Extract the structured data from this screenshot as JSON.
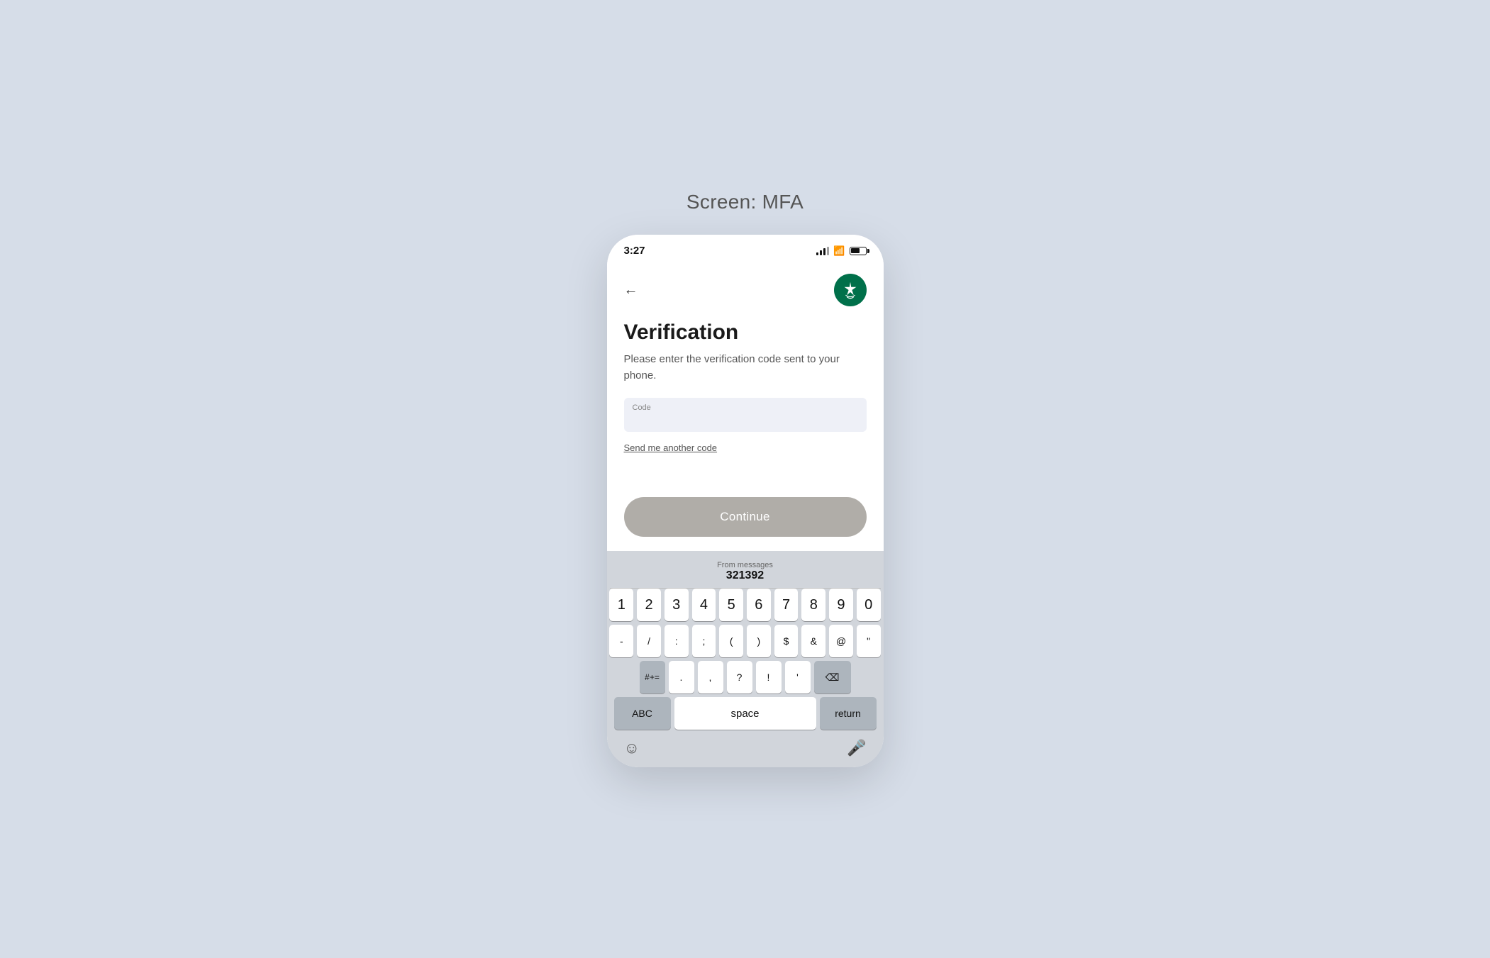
{
  "screen": {
    "label": "Screen: MFA"
  },
  "status_bar": {
    "time": "3:27",
    "signal_level": 3,
    "wifi": true,
    "battery": 65
  },
  "nav": {
    "back_label": "←"
  },
  "page": {
    "title": "Verification",
    "description": "Please enter the verification code sent to your phone.",
    "code_label": "Code",
    "code_value": "",
    "resend_label": "Send me another code",
    "continue_label": "Continue"
  },
  "keyboard": {
    "suggestion_from": "From messages",
    "suggestion_code": "321392",
    "row_numbers": [
      "1",
      "2",
      "3",
      "4",
      "5",
      "6",
      "7",
      "8",
      "9",
      "0"
    ],
    "row_symbols": [
      "-",
      "/",
      ":",
      ";",
      "(",
      ")",
      "$",
      "&",
      "@",
      "\""
    ],
    "row_special": [
      "#+= ",
      " . ",
      ",",
      " ? ",
      " ! ",
      " ' ",
      "⌫"
    ],
    "abc_label": "ABC",
    "space_label": "space",
    "return_label": "return"
  }
}
